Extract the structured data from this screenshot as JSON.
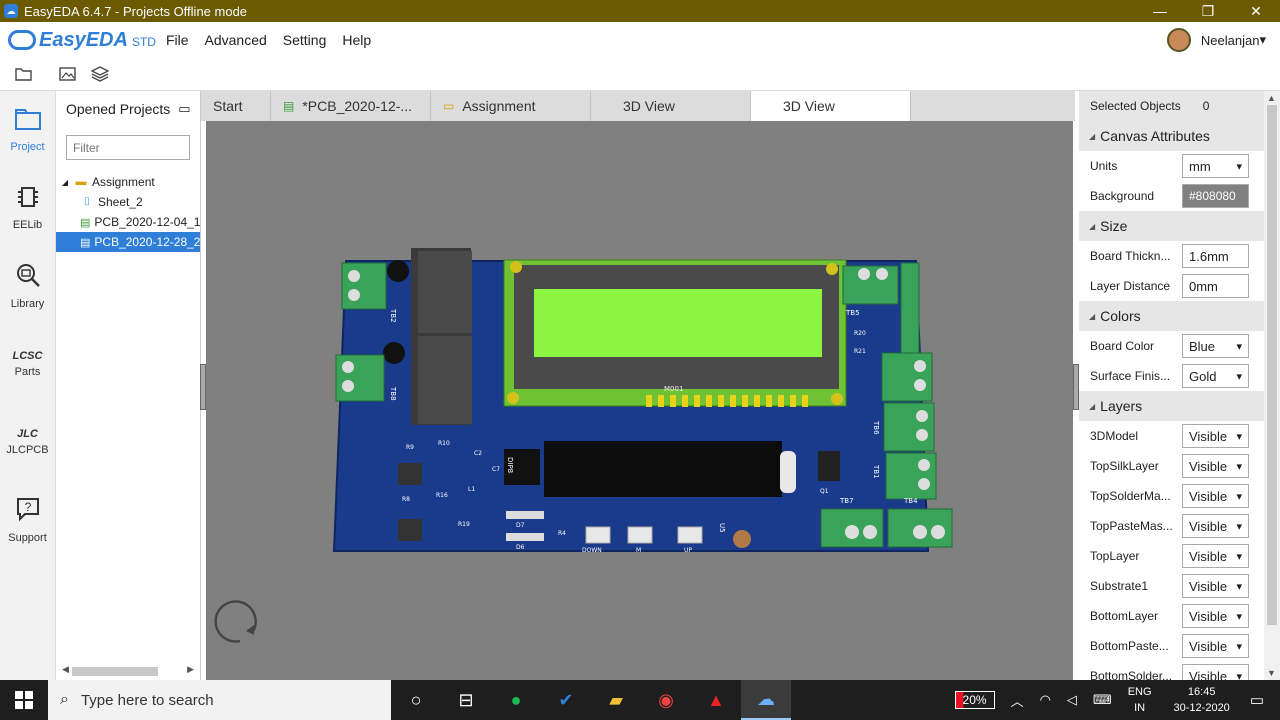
{
  "window": {
    "title": "EasyEDA 6.4.7 - Projects Offline mode",
    "minimize": "—",
    "restore": "❐",
    "close": "✕"
  },
  "menubar": {
    "logo_text": "EasyEDA",
    "logo_edition": "STD",
    "items": [
      "File",
      "Advanced",
      "Setting",
      "Help"
    ],
    "user_name": "Neelanjan",
    "user_caret": "▾"
  },
  "rail": [
    {
      "label": "Project",
      "icon": "folder-icon"
    },
    {
      "label": "EELib",
      "icon": "chip-icon"
    },
    {
      "label": "Library",
      "icon": "library-icon"
    },
    {
      "label": "Parts",
      "icon": "lcsc-icon"
    },
    {
      "label": "JLCPCB",
      "icon": "jlc-icon"
    },
    {
      "label": "Support",
      "icon": "help-icon"
    }
  ],
  "projects": {
    "header": "Opened Projects",
    "filter_placeholder": "Filter",
    "tree": [
      {
        "label": "Assignment",
        "type": "folder"
      },
      {
        "label": "Sheet_2",
        "type": "schematic"
      },
      {
        "label": "PCB_2020-12-04_1",
        "type": "pcb"
      },
      {
        "label": "PCB_2020-12-28_2",
        "type": "pcb",
        "selected": true
      }
    ]
  },
  "tabs": [
    {
      "label": "Start"
    },
    {
      "label": "*PCB_2020-12-..."
    },
    {
      "label": "Assignment"
    },
    {
      "label": "3D View"
    },
    {
      "label": "3D View",
      "active": true
    }
  ],
  "props": {
    "selected_label": "Selected Objects",
    "selected_count": "0",
    "sections": {
      "canvas": "Canvas Attributes",
      "size": "Size",
      "colors": "Colors",
      "layers": "Layers"
    },
    "canvas_rows": [
      {
        "label": "Units",
        "value": "mm"
      },
      {
        "label": "Background",
        "value": "#808080"
      }
    ],
    "size_rows": [
      {
        "label": "Board Thickn...",
        "value": "1.6mm"
      },
      {
        "label": "Layer Distance",
        "value": "0mm"
      }
    ],
    "color_rows": [
      {
        "label": "Board Color",
        "value": "Blue"
      },
      {
        "label": "Surface Finis...",
        "value": "Gold"
      }
    ],
    "layer_rows": [
      {
        "label": "3DModel",
        "value": "Visible"
      },
      {
        "label": "TopSilkLayer",
        "value": "Visible"
      },
      {
        "label": "TopSolderMa...",
        "value": "Visible"
      },
      {
        "label": "TopPasteMas...",
        "value": "Visible"
      },
      {
        "label": "TopLayer",
        "value": "Visible"
      },
      {
        "label": "Substrate1",
        "value": "Visible"
      },
      {
        "label": "BottomLayer",
        "value": "Visible"
      },
      {
        "label": "BottomPaste...",
        "value": "Visible"
      },
      {
        "label": "BottomSolder...",
        "value": "Visible"
      }
    ]
  },
  "pcb": {
    "board_color": "#1a3a8c",
    "lcd_color": "#8cf542",
    "label_header": "M001",
    "labels": [
      "TB2",
      "TB8",
      "TB5",
      "TB6",
      "TB1",
      "TB7",
      "TB4",
      "DIP8",
      "U5",
      "DOWN",
      "M",
      "UP",
      "D6",
      "D7",
      "R9",
      "R10",
      "R8",
      "R16",
      "L1",
      "R19",
      "R4",
      "C2",
      "C7",
      "Q1",
      "R20",
      "R21"
    ]
  },
  "taskbar": {
    "search_placeholder": "Type here to search",
    "battery": "20%",
    "lang_top": "ENG",
    "lang_bottom": "IN",
    "time": "16:45",
    "date": "30-12-2020"
  }
}
